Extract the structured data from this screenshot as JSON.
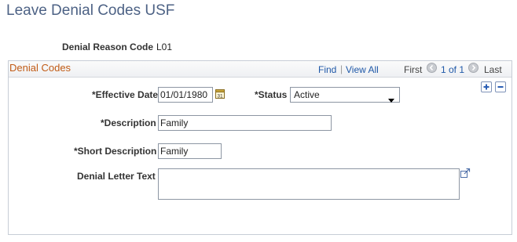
{
  "page": {
    "title": "Leave Denial Codes USF",
    "reason_code_label": "Denial Reason Code",
    "reason_code_value": "L01"
  },
  "grid": {
    "title": "Denial Codes",
    "find": "Find",
    "separator": "|",
    "view_all": "View All",
    "first": "First",
    "position": "1 of 1",
    "last": "Last"
  },
  "form": {
    "effective_date_label": "*Effective Date",
    "effective_date_value": "01/01/1980",
    "status_label": "*Status",
    "status_value": "Active",
    "description_label": "*Description",
    "description_value": "Family",
    "short_description_label": "*Short Description",
    "short_description_value": "Family",
    "letter_text_label": "Denial Letter Text",
    "letter_text_value": ""
  },
  "icons": {
    "calendar": "calendar-icon",
    "prev": "chevron-left-icon",
    "next": "chevron-right-icon",
    "add": "plus-icon",
    "delete": "minus-icon",
    "expand": "expand-icon"
  },
  "colors": {
    "title": "#4d6285",
    "panel_title": "#c15b16",
    "link": "#1f58a8"
  }
}
